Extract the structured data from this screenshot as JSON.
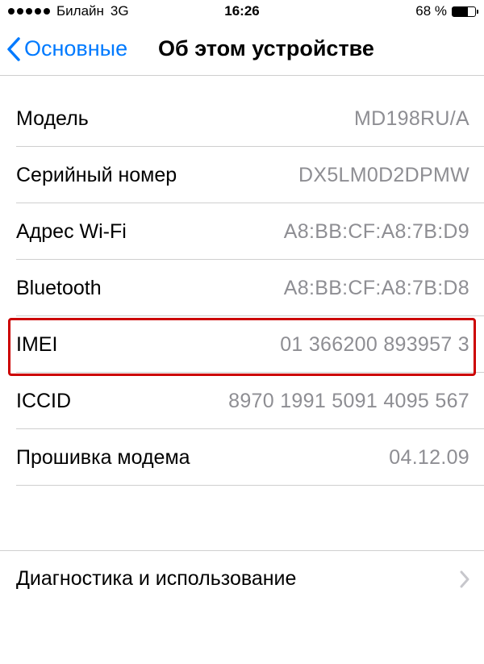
{
  "status_bar": {
    "carrier": "Билайн",
    "network": "3G",
    "time": "16:26",
    "battery_percent": "68 %"
  },
  "nav": {
    "back_label": "Основные",
    "title": "Об этом устройстве"
  },
  "rows": {
    "model": {
      "label": "Модель",
      "value": "MD198RU/A"
    },
    "serial": {
      "label": "Серийный номер",
      "value": "DX5LM0D2DPMW"
    },
    "wifi": {
      "label": "Адрес Wi-Fi",
      "value": "A8:BB:CF:A8:7B:D9"
    },
    "bluetooth": {
      "label": "Bluetooth",
      "value": "A8:BB:CF:A8:7B:D8"
    },
    "imei": {
      "label": "IMEI",
      "value": "01 366200 893957 3"
    },
    "iccid": {
      "label": "ICCID",
      "value": "8970 1991 5091 4095 567"
    },
    "modem": {
      "label": "Прошивка модема",
      "value": "04.12.09"
    }
  },
  "diagnostics": {
    "label": "Диагностика и использование"
  },
  "colors": {
    "accent": "#007aff",
    "secondary_text": "#8e8e93",
    "highlight_border": "#cc0000"
  }
}
